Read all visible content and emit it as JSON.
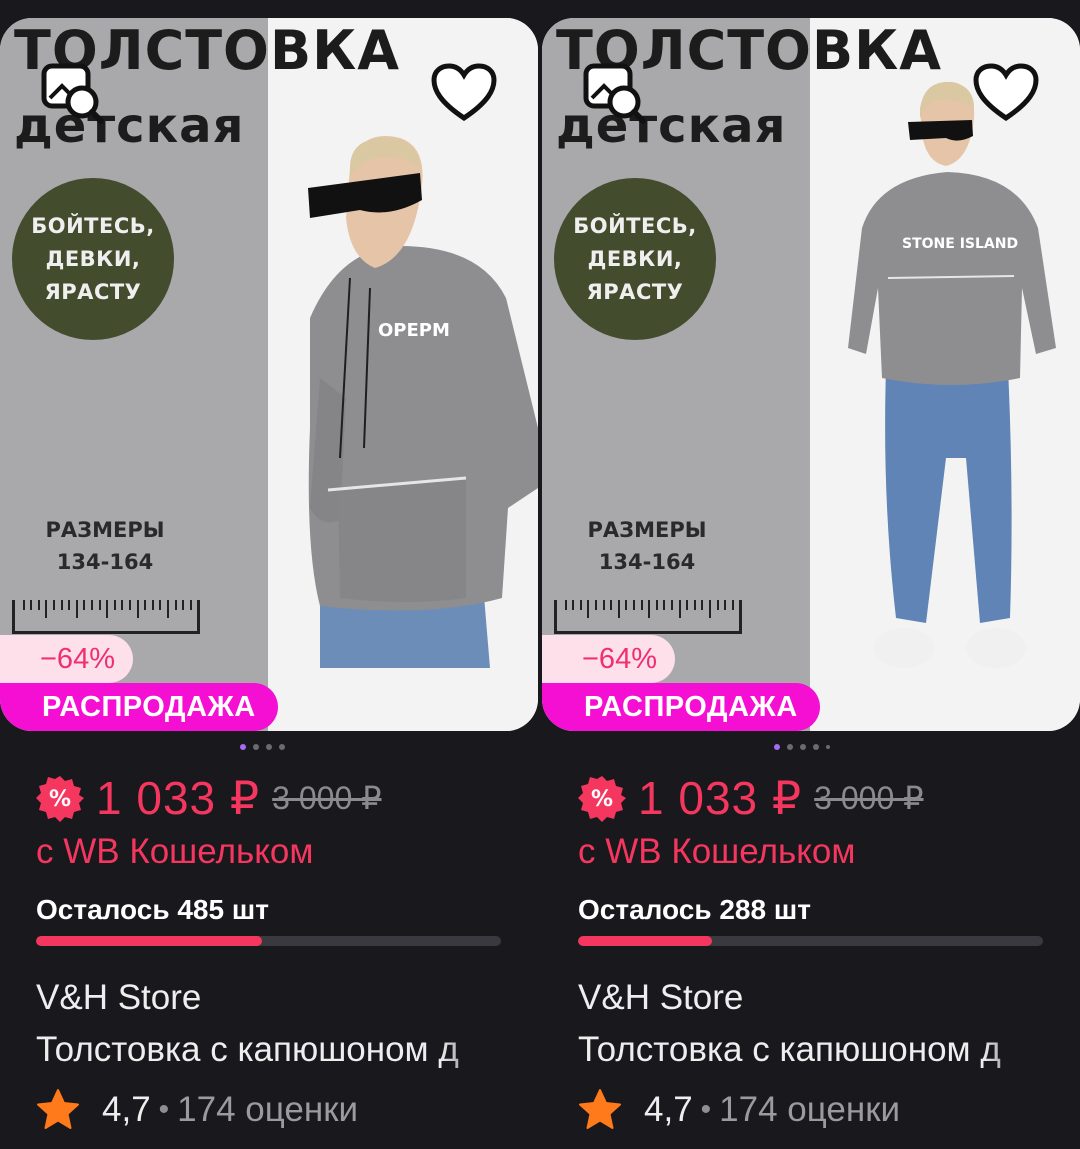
{
  "colors": {
    "accent_price": "#f5375f",
    "sale_badge": "#f40fd2",
    "discount_badge_bg": "#fde0e9",
    "background": "#19181d",
    "star": "#ff7a1a"
  },
  "icons": {
    "similar_search": "image-search-icon",
    "favorite": "heart-icon",
    "wallet_discount": "wallet-discount-icon",
    "rating": "star-icon"
  },
  "products": [
    {
      "image_text": {
        "title": "ТОЛСТОВКА",
        "subtitle": "детская",
        "slogan": "БОЙТЕСЬ,\nДЕВКИ,\nЯРАСТУ",
        "sizes": "РАЗМЕРЫ\n134-164",
        "chest_print": "OPEPM"
      },
      "discount": "−64%",
      "sale_label": "РАСПРОДАЖА",
      "carousel": {
        "count": 4,
        "active": 0
      },
      "price": "1 033 ₽",
      "old_price": "3 000 ₽",
      "wallet_note": "с WB Кошельком",
      "stock_text": "Осталось 485 шт",
      "stock_fraction": 0.485,
      "brand": "V&H Store",
      "name": "Толстовка с капюшоном д",
      "rating": "4,7",
      "separator": "•",
      "reviews": "174 оценки"
    },
    {
      "image_text": {
        "title": "ТОЛСТОВКА",
        "subtitle": "детская",
        "slogan": "БОЙТЕСЬ,\nДЕВКИ,\nЯРАСТУ",
        "sizes": "РАЗМЕРЫ\n134-164",
        "chest_print": "STONE ISLAND"
      },
      "discount": "−64%",
      "sale_label": "РАСПРОДАЖА",
      "carousel": {
        "count": 5,
        "active": 0
      },
      "price": "1 033 ₽",
      "old_price": "3 000 ₽",
      "wallet_note": "с WB Кошельком",
      "stock_text": "Осталось 288 шт",
      "stock_fraction": 0.288,
      "brand": "V&H Store",
      "name": "Толстовка с капюшоном д",
      "rating": "4,7",
      "separator": "•",
      "reviews": "174 оценки"
    }
  ]
}
